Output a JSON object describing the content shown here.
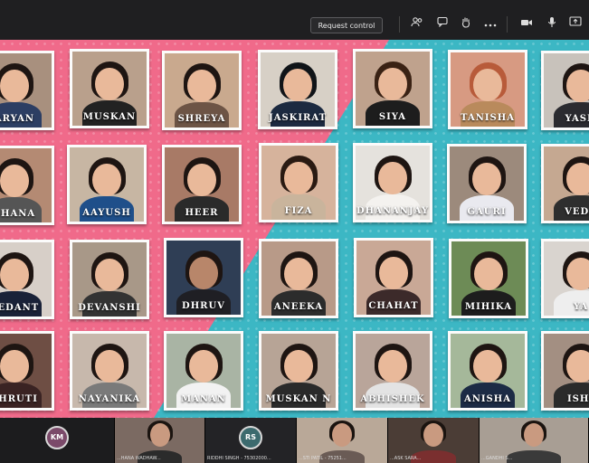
{
  "toolbar": {
    "request_control_label": "Request control",
    "icons": [
      "people-icon",
      "chat-icon",
      "raise-hand-icon",
      "more-icon",
      "camera-icon",
      "microphone-icon",
      "share-screen-icon"
    ]
  },
  "grid": {
    "row1": [
      "ARYAN",
      "MUSKAN",
      "SHREYA",
      "JASKIRAT",
      "SIYA",
      "TANISHA",
      "YASH"
    ],
    "row2": [
      "SHANA",
      "AAYUSH",
      "HEER",
      "FIZA",
      "DHANANJAY",
      "GAURI",
      "VEDA"
    ],
    "row3": [
      "VEDANT",
      "DEVANSHI",
      "DHRUV",
      "ANEEKA",
      "CHAHAT",
      "MIHIKA",
      "YA"
    ],
    "row4": [
      "SHRUTI",
      "NAYANIKA",
      "MANAN",
      "MUSKAN N",
      "ABHISHEK",
      "ANISHA",
      "ISHI"
    ]
  },
  "participants": [
    {
      "initials": "KM",
      "name": ""
    },
    {
      "initials": "",
      "name": "...HANA WADHAW..."
    },
    {
      "initials": "RS",
      "name": "RIDDHI SINGH - 75302000..."
    },
    {
      "initials": "",
      "name": "...STI PATIL - 75251..."
    },
    {
      "initials": "",
      "name": "...ASK SARA..."
    },
    {
      "initials": "",
      "name": "...GANDHI S..."
    }
  ],
  "colors": {
    "pink_panel": "#f06a8a",
    "teal_panel": "#3cb7c4",
    "toolbar_bg": "#1f1f21"
  }
}
